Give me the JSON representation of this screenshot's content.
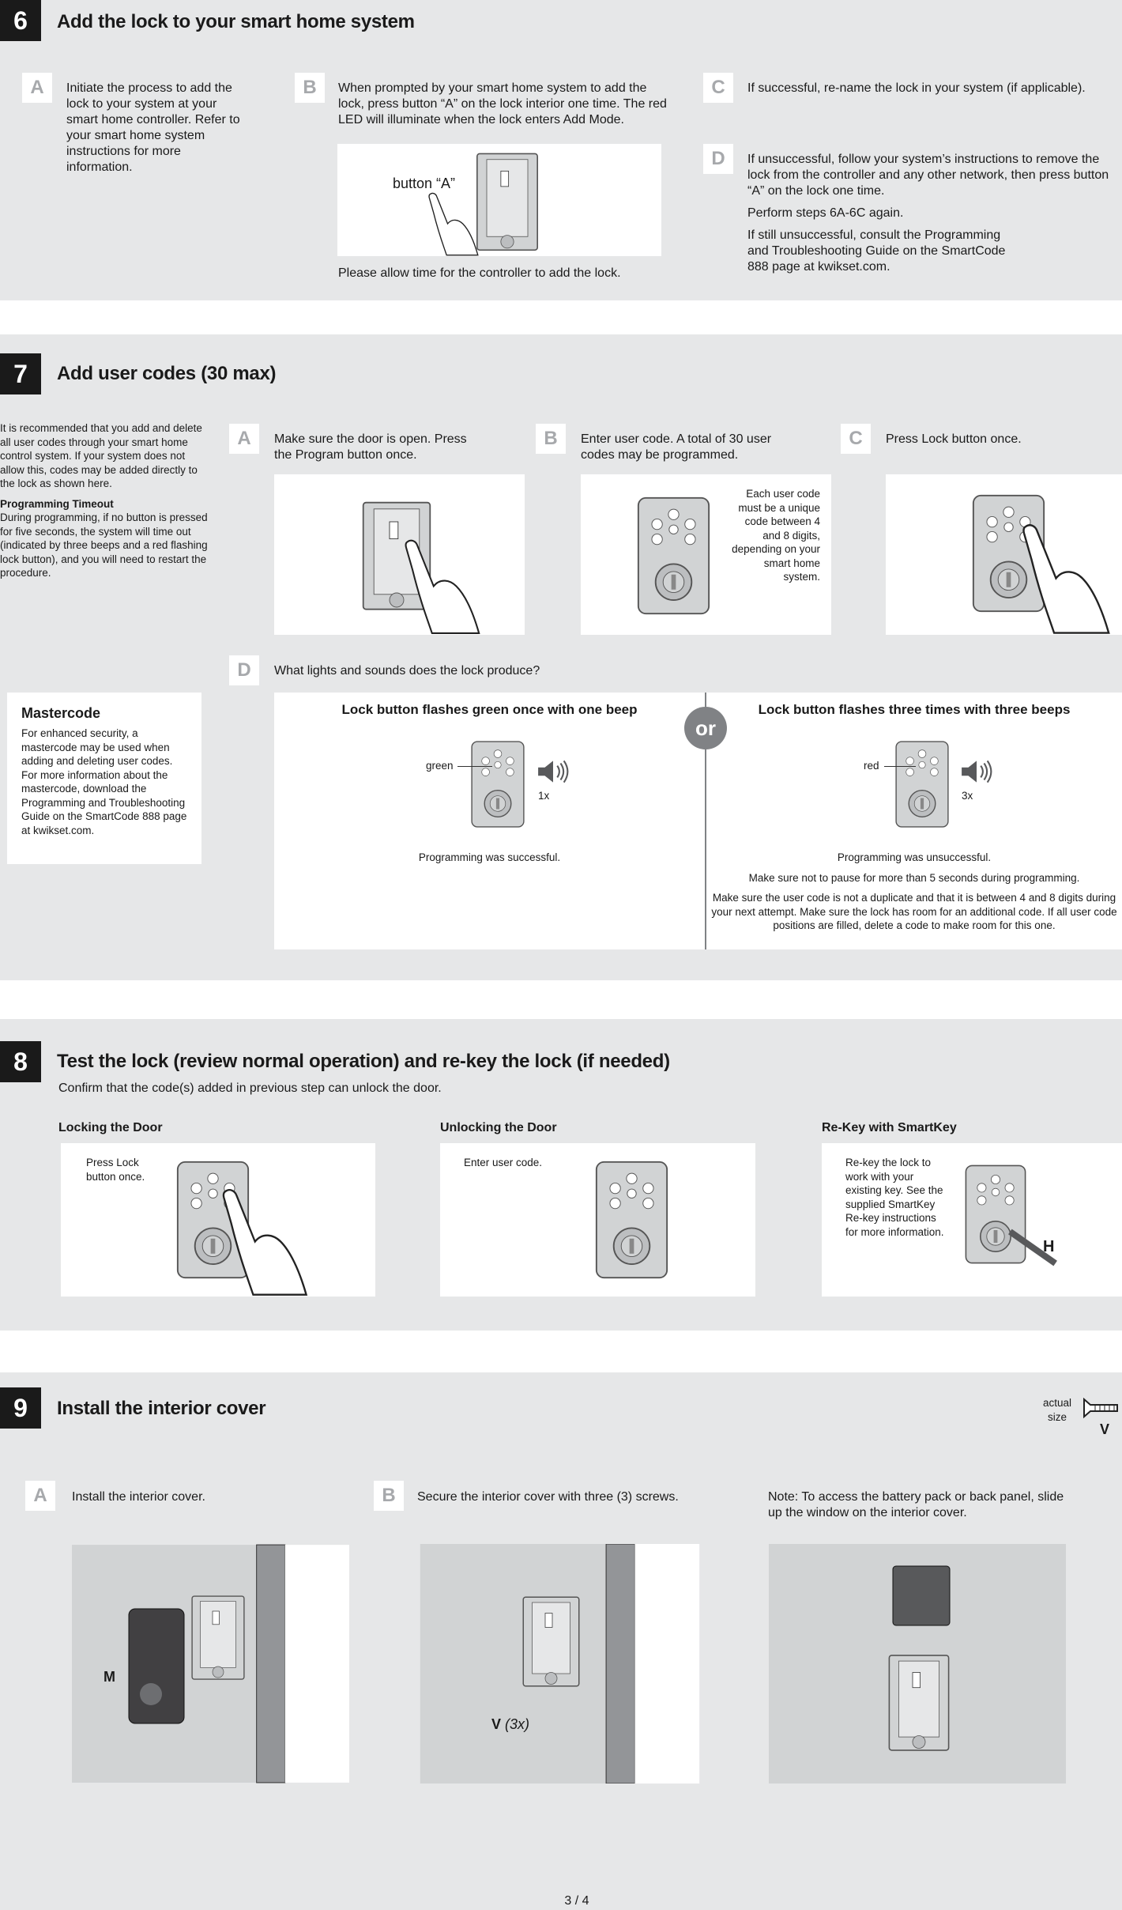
{
  "s6": {
    "num": "6",
    "title": "Add the lock to your smart home system",
    "a": {
      "letter": "A",
      "text": "Initiate the process to add the lock to your system at your smart home controller. Refer to your smart home system instructions for more information."
    },
    "b": {
      "letter": "B",
      "text": "When prompted by your smart home system to add the lock, press button “A” on the lock interior one time. The red LED will illuminate when the lock enters Add Mode.",
      "callout": "button “A”",
      "caption": "Please allow time for the controller to add the lock."
    },
    "c": {
      "letter": "C",
      "text": "If successful, re-name the lock in your system (if applicable)."
    },
    "d": {
      "letter": "D",
      "p1": "If unsuccessful, follow your system’s instructions to remove the lock from the controller and any other network, then press button “A” on the lock one time.",
      "p2": "Perform steps 6A-6C again.",
      "p3": "If still unsuccessful, consult the Programming and Troubleshooting Guide on the SmartCode 888 page at kwikset.com."
    }
  },
  "s7": {
    "num": "7",
    "title": "Add user codes (30 max)",
    "intro": "It is recommended that you add and delete all user codes through your smart home control system. If your system does not allow this, codes may be added directly to the lock as shown here.",
    "timeout_title": "Programming Timeout",
    "timeout_text": "During programming, if no button is pressed for five seconds, the system will time out (indicated by three beeps and a red flashing lock button), and you will need to restart the procedure.",
    "master_title": "Mastercode",
    "master_text": "For enhanced security, a mastercode may be used when adding and deleting user codes. For more information about the mastercode, download the Programming and Troubleshooting Guide on the SmartCode  888 page at kwikset.com.",
    "a": {
      "letter": "A",
      "text": "Make sure the door is open. Press the Program button once."
    },
    "b": {
      "letter": "B",
      "text": "Enter user code. A total of 30 user codes may be programmed.",
      "note": "Each user code must be a unique code between 4 and 8 digits, depending on your smart home system."
    },
    "c": {
      "letter": "C",
      "text": "Press Lock button once."
    },
    "d": {
      "letter": "D",
      "text": "What lights and sounds does the lock produce?",
      "or": "or",
      "left": {
        "heading": "Lock button flashes green once with one beep",
        "color_label": "green",
        "count": "1x",
        "result": "Programming was successful."
      },
      "right": {
        "heading": "Lock button flashes three times with three beeps",
        "color_label": "red",
        "count": "3x",
        "r1": "Programming was unsuccessful.",
        "r2": "Make sure not to pause for more than 5 seconds during programming.",
        "r3": "Make sure the user code is not a duplicate and that it is between 4 and 8 digits during your next attempt. Make sure the lock has room for an additional code. If all user code positions are filled, delete a code to make room for this one."
      }
    }
  },
  "s8": {
    "num": "8",
    "title": "Test the lock (review normal operation) and re-key the lock (if needed)",
    "intro": "Confirm that the code(s) added in previous step can unlock the door.",
    "locking": {
      "title": "Locking the Door",
      "text": "Press Lock button once."
    },
    "unlocking": {
      "title": "Unlocking the Door",
      "text": "Enter user code."
    },
    "rekey": {
      "title": "Re-Key with SmartKey",
      "text": "Re-key the lock to work with your existing key. See the supplied SmartKey Re-key instructions for more information.",
      "label": "H"
    }
  },
  "s9": {
    "num": "9",
    "title": "Install the interior cover",
    "actual_size": "actual size",
    "screw_label": "V",
    "a": {
      "letter": "A",
      "text": "Install the interior cover.",
      "label": "M"
    },
    "b": {
      "letter": "B",
      "text": "Secure the interior cover with three (3) screws.",
      "label": "V",
      "qty": "(3x)"
    },
    "note": "Note: To access the battery pack or back panel, slide up the window on the interior cover."
  },
  "page": "3 / 4"
}
